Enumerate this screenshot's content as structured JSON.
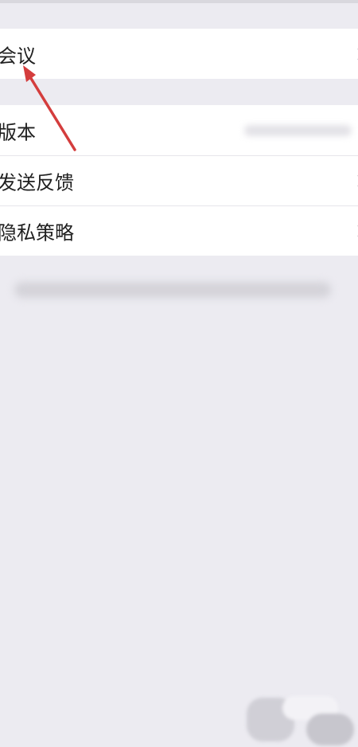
{
  "settings": {
    "rows": [
      {
        "label": "会议",
        "has_chevron": true
      },
      {
        "label": "版本",
        "has_chevron": false,
        "value_blurred": true
      },
      {
        "label": "发送反馈",
        "has_chevron": true
      },
      {
        "label": "隐私策略",
        "has_chevron": true
      }
    ]
  },
  "annotation": {
    "arrow_color": "#d43d3d"
  },
  "icons": [
    "chevron-right-icon"
  ]
}
